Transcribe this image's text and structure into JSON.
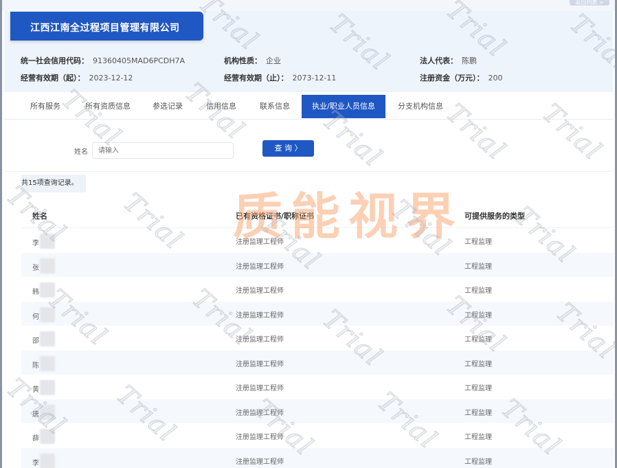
{
  "topbar": {
    "back_label": "返回列表 >"
  },
  "company": {
    "name": "江西江南全过程项目管理有限公司",
    "credit_code_label": "统一社会信用代码：",
    "credit_code": "91360405MAD6PCDH7A",
    "nature_label": "机构性质：",
    "nature": "企业",
    "legal_rep_label": "法人代表：",
    "legal_rep": "陈鹏",
    "valid_from_label": "经营有效期（起）：",
    "valid_from": "2023-12-12",
    "valid_to_label": "经营有效期（止）：",
    "valid_to": "2073-12-11",
    "capital_label": "注册资金（万元）：",
    "capital": "200"
  },
  "tabs": [
    {
      "label": "所有服务"
    },
    {
      "label": "所有资质信息"
    },
    {
      "label": "参选记录"
    },
    {
      "label": "信用信息"
    },
    {
      "label": "联系信息"
    },
    {
      "label": "执业/职业人员信息",
      "active": true
    },
    {
      "label": "分支机构信息"
    }
  ],
  "search": {
    "name_label": "姓名",
    "placeholder": "请输入",
    "button_label": "查 询 〉"
  },
  "result_count": "共15项查询记录。",
  "table": {
    "headers": [
      "姓名",
      "已有资格证书/职称证书",
      "可提供服务的类型"
    ],
    "rows": [
      {
        "name": "李",
        "cert": "注册监理工程师",
        "service": "工程监理"
      },
      {
        "name": "张",
        "cert": "注册监理工程师",
        "service": "工程监理"
      },
      {
        "name": "韩",
        "cert": "注册监理工程师",
        "service": "工程监理"
      },
      {
        "name": "何",
        "cert": "注册监理工程师",
        "service": "工程监理"
      },
      {
        "name": "邵",
        "cert": "注册监理工程师",
        "service": "工程监理"
      },
      {
        "name": "陈",
        "cert": "注册监理工程师",
        "service": "工程监理"
      },
      {
        "name": "黄",
        "cert": "注册监理工程师",
        "service": "工程监理"
      },
      {
        "name": "唐",
        "cert": "注册监理工程师",
        "service": "工程监理"
      },
      {
        "name": "薛",
        "cert": "注册监理工程师",
        "service": "工程监理"
      },
      {
        "name": "李",
        "cert": "注册监理工程师",
        "service": "工程监理"
      }
    ]
  },
  "watermark": {
    "text": "质能视界",
    "trial": "Trial"
  }
}
